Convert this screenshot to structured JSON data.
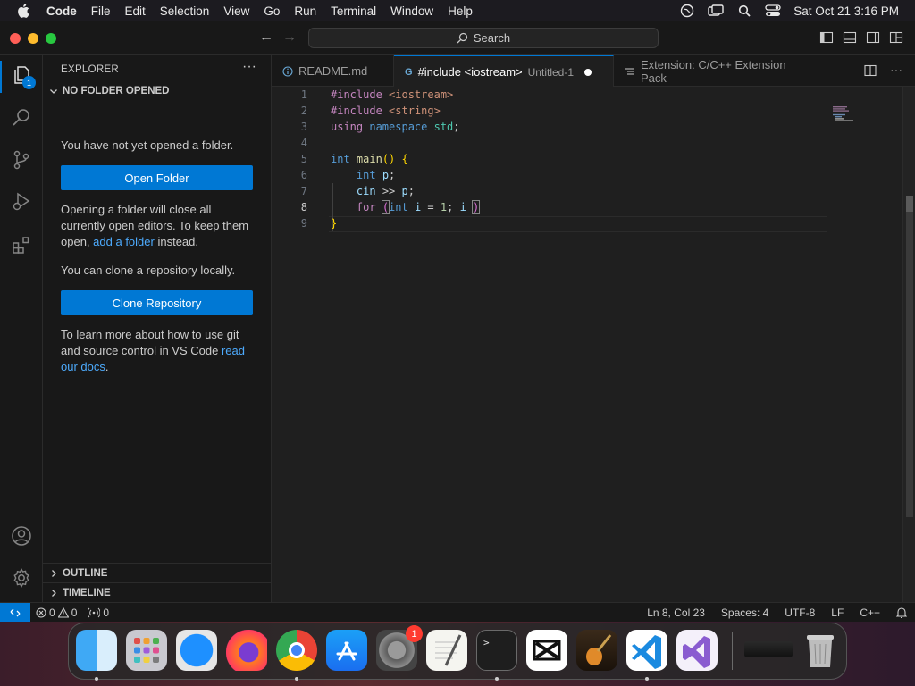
{
  "menubar": {
    "app_name": "Code",
    "items": [
      "File",
      "Edit",
      "Selection",
      "View",
      "Go",
      "Run",
      "Terminal",
      "Window",
      "Help"
    ],
    "clock": "Sat Oct 21  3:16 PM"
  },
  "titlebar": {
    "search_label": "Search"
  },
  "activitybar": {
    "explorer_badge": "1"
  },
  "sidebar": {
    "title": "EXPLORER",
    "more": "···",
    "section_title": "NO FOLDER OPENED",
    "no_folder_text": "You have not yet opened a folder.",
    "open_folder_button": "Open Folder",
    "info_text_1": "Opening a folder will close all currently open editors. To keep them open,",
    "add_folder_link": "add a folder",
    "info_text_2": "instead.",
    "clone_text": "You can clone a repository locally.",
    "clone_button": "Clone Repository",
    "learn_text": "To learn more about how to use git and source control in VS Code",
    "read_docs_link": "read our docs",
    "learn_end": ".",
    "outline_label": "OUTLINE",
    "timeline_label": "TIMELINE"
  },
  "tabs": [
    {
      "label": "README.md",
      "description": "",
      "icon": "info-icon",
      "active": false
    },
    {
      "label": "#include <iostream>",
      "description": "Untitled-1",
      "icon": "cpp-file-icon",
      "active": true,
      "dirty": true
    },
    {
      "label": "Extension: C/C++ Extension Pack",
      "description": "",
      "icon": "extension-page-icon",
      "active": false
    }
  ],
  "editor": {
    "line_numbers": [
      "1",
      "2",
      "3",
      "4",
      "5",
      "6",
      "7",
      "8",
      "9"
    ],
    "current_line": 8
  },
  "statusbar": {
    "errors": "0",
    "warnings": "0",
    "ports": "0",
    "position": "Ln 8, Col 23",
    "spaces": "Spaces: 4",
    "encoding": "UTF-8",
    "eol": "LF",
    "language": "C++"
  },
  "dock": {
    "apps": [
      "Finder",
      "Launchpad",
      "Safari",
      "Firefox",
      "Chrome",
      "App Store",
      "System Settings",
      "TextEdit",
      "Terminal",
      "CapCut",
      "GarageBand",
      "Visual Studio Code",
      "Visual Studio",
      "Recent Item",
      "Trash"
    ],
    "settings_badge": "1"
  },
  "colors": {
    "accent": "#0078d4",
    "link": "#4daafc",
    "keyword": "#569cd6",
    "preprocessor": "#c586c0",
    "string": "#ce9178"
  }
}
